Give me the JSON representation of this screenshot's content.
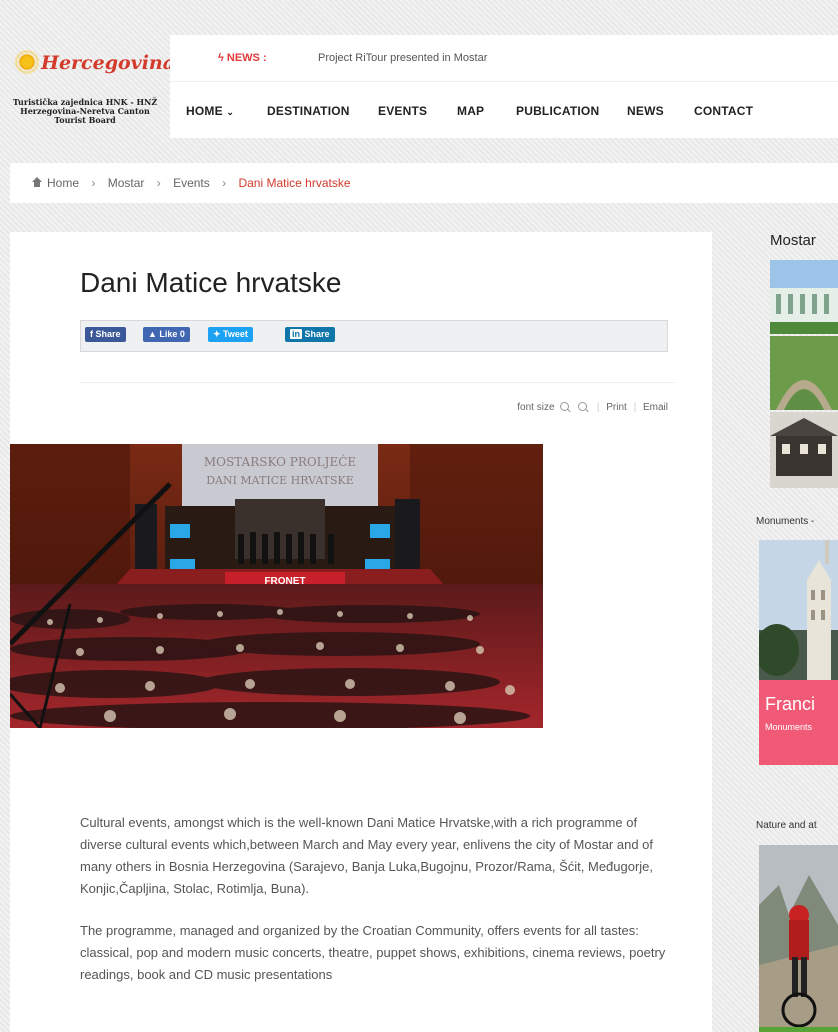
{
  "brand": {
    "name": "Hercegovina",
    "subtitle_lines": [
      "Turistička zajednica HNK - HNŽ",
      "Herzegovina-Neretva Canton",
      "Tourist Board"
    ]
  },
  "news": {
    "label": "NEWS :",
    "headline": "Project RiTour presented in Mostar"
  },
  "nav": {
    "items": [
      "HOME",
      "DESTINATION",
      "EVENTS",
      "MAP",
      "PUBLICATION",
      "NEWS",
      "CONTACT"
    ]
  },
  "breadcrumb": {
    "items": [
      "Home",
      "Mostar",
      "Events"
    ],
    "current": "Dani Matice hrvatske"
  },
  "article": {
    "title": "Dani Matice hrvatske",
    "share": {
      "facebook": "Share",
      "like": "Like 0",
      "tweet": "Tweet",
      "linkedin": "Share"
    },
    "tools": {
      "font_size": "font size",
      "print": "Print",
      "email": "Email"
    },
    "photo": {
      "banner_line1": "MOSTARSKO PROLJEĆE",
      "banner_line2": "DANI MATICE HRVATSKE",
      "stage_sign": "FRONET"
    },
    "paragraphs": [
      "Cultural events, amongst which is the well-known Dani Matice Hrvatske,with a rich programme of diverse cultural events which,between March and May every year, enlivens the city of Mostar and of many others in Bosnia Herzegovina (Sarajevo, Banja Luka,Bugojnu, Prozor/Rama, Šćit, Međugorje, Konjic,Čapljina, Stolac, Rotimlja, Buna).",
      "The programme, managed and organized by the Croatian Community, offers events for all tastes: classical, pop and modern music concerts, theatre, puppet shows, exhibitions, cinema reviews, poetry readings, book and CD music presentations"
    ]
  },
  "sidebar": {
    "heading": "Mostar",
    "section1_label": "Monuments -",
    "card1": {
      "title": "Franci",
      "category": "Monuments"
    },
    "section2_label": "Nature and at"
  },
  "colors": {
    "accent_red": "#d33a2b",
    "card_pink": "#f05a77",
    "facebook_blue": "#3b5998",
    "twitter_blue": "#1da1f2",
    "linkedin_blue": "#0e76a8"
  }
}
